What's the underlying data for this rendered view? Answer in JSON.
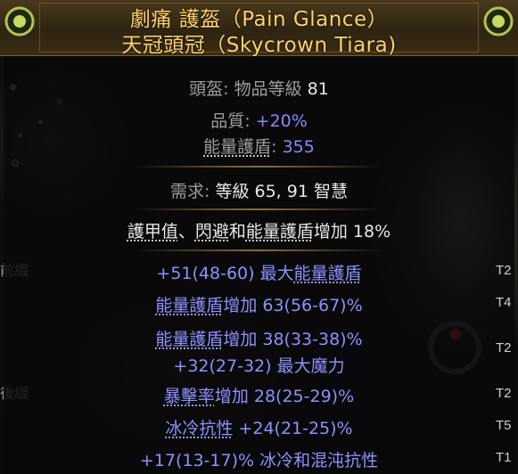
{
  "item": {
    "name": "劇痛 護盔（Pain Glance）",
    "base": "天冠頭冠（Skycrown Tiara)",
    "type_label": "頭盔",
    "item_level_label": "物品等級",
    "item_level": "81",
    "quality_label": "品質",
    "quality_value": "+20%",
    "es_label": "能量護盾",
    "es_value": "355",
    "req_label": "需求",
    "req_text": "等級 65, 91",
    "req_stat": "智慧",
    "implicit": {
      "parts": [
        "護甲值",
        "、",
        "閃避",
        "和",
        "能量護盾",
        "增加 18%"
      ]
    },
    "mods": [
      {
        "pre": "+51(48-60) 最大",
        "key": "能量護盾",
        "post": "",
        "tier": "T2"
      },
      {
        "pre": "",
        "key": "能量護盾",
        "post": "增加 63(56-67)%",
        "tier": "T4"
      },
      {
        "pre": "",
        "key": "能量護盾",
        "post": "增加 38(33-38)%",
        "tier": "T2"
      },
      {
        "pre": "+32(27-32) 最大魔力",
        "key": "",
        "post": "",
        "tier": ""
      },
      {
        "pre": "",
        "key": "暴擊率",
        "post": "增加 28(25-29)%",
        "tier": "T2"
      },
      {
        "pre": "",
        "key": "冰冷抗性",
        "post": " +24(21-25)%",
        "tier": "T5"
      },
      {
        "pre": "+17(13-17)% 冰冷和混沌抗性",
        "key": "",
        "post": "",
        "tier": "T1"
      }
    ]
  },
  "side_labels": {
    "prefix": "前綴",
    "suffix": "後綴"
  },
  "colors": {
    "name": "#ffd36a",
    "mod": "#8f8fff",
    "label": "#9c9c9c"
  }
}
